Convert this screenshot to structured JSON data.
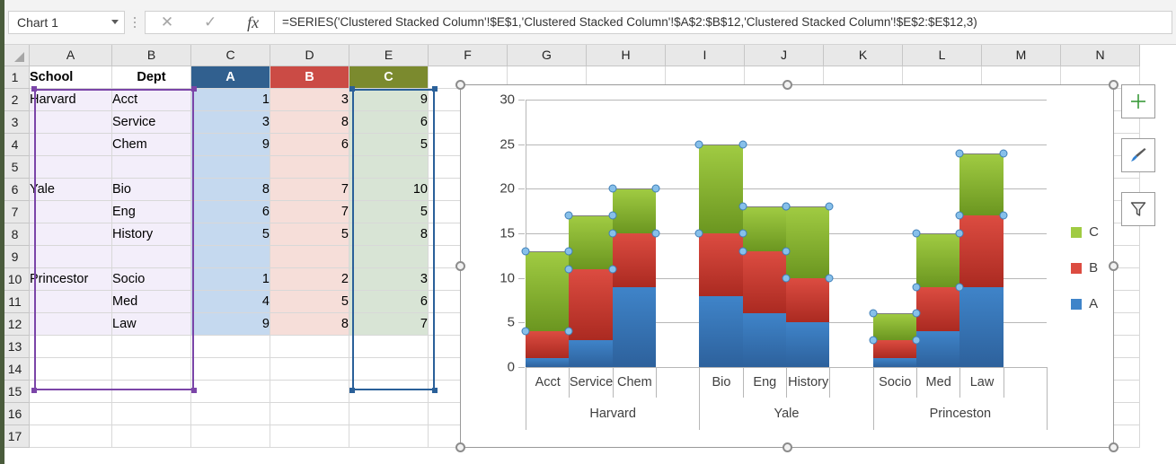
{
  "formula_bar": {
    "name_box": "Chart 1",
    "cancel_icon": "close-icon",
    "confirm_icon": "check-icon",
    "function_icon": "fx-icon",
    "formula": "=SERIES('Clustered Stacked Column'!$E$1,'Clustered Stacked Column'!$A$2:$B$12,'Clustered Stacked Column'!$E$2:$E$12,3)"
  },
  "sheet": {
    "column_headers": [
      "A",
      "B",
      "C",
      "D",
      "E",
      "F",
      "G",
      "H",
      "I",
      "J",
      "K",
      "L",
      "M",
      "N"
    ],
    "row_numbers": [
      "1",
      "2",
      "3",
      "4",
      "5",
      "6",
      "7",
      "8",
      "9",
      "10",
      "11",
      "12",
      "13",
      "14",
      "15",
      "16",
      "17"
    ],
    "header_row": {
      "a": "School",
      "b": "Dept",
      "c": "A",
      "d": "B",
      "e": "C"
    },
    "rows": [
      {
        "n": "2",
        "school": "Harvard",
        "dept": "Acct",
        "a": "1",
        "b": "3",
        "c": "9"
      },
      {
        "n": "3",
        "school": "",
        "dept": "Service",
        "a": "3",
        "b": "8",
        "c": "6"
      },
      {
        "n": "4",
        "school": "",
        "dept": "Chem",
        "a": "9",
        "b": "6",
        "c": "5"
      },
      {
        "n": "5",
        "school": "",
        "dept": "",
        "a": "",
        "b": "",
        "c": ""
      },
      {
        "n": "6",
        "school": "Yale",
        "dept": "Bio",
        "a": "8",
        "b": "7",
        "c": "10"
      },
      {
        "n": "7",
        "school": "",
        "dept": "Eng",
        "a": "6",
        "b": "7",
        "c": "5"
      },
      {
        "n": "8",
        "school": "",
        "dept": "History",
        "a": "5",
        "b": "5",
        "c": "8"
      },
      {
        "n": "9",
        "school": "",
        "dept": "",
        "a": "",
        "b": "",
        "c": ""
      },
      {
        "n": "10",
        "school": "Princestor",
        "dept": "Socio",
        "a": "1",
        "b": "2",
        "c": "3"
      },
      {
        "n": "11",
        "school": "",
        "dept": "Med",
        "a": "4",
        "b": "5",
        "c": "6"
      },
      {
        "n": "12",
        "school": "",
        "dept": "Law",
        "a": "9",
        "b": "8",
        "c": "7"
      }
    ],
    "empty_rows": [
      "13",
      "14",
      "15",
      "16",
      "17"
    ],
    "header_colors": {
      "a": "#31608f",
      "b": "#cb4b45",
      "c": "#7b8a2e"
    }
  },
  "chart_buttons": [
    {
      "name": "chart-elements-button",
      "icon": "plus-icon"
    },
    {
      "name": "chart-styles-button",
      "icon": "paintbrush-icon"
    },
    {
      "name": "chart-filters-button",
      "icon": "funnel-icon"
    }
  ],
  "chart_data": {
    "type": "bar",
    "title": "",
    "xlabel": "",
    "ylabel": "",
    "ylim": [
      0,
      30
    ],
    "yticks": [
      0,
      5,
      10,
      15,
      20,
      25,
      30
    ],
    "grid": true,
    "stacked": true,
    "legend_position": "right",
    "groups": [
      "Harvard",
      "Yale",
      "Princeston"
    ],
    "categories": [
      "Acct",
      "Service",
      "Chem",
      "Bio",
      "Eng",
      "History",
      "Socio",
      "Med",
      "Law"
    ],
    "category_groups": [
      {
        "group": "Harvard",
        "categories": [
          "Acct",
          "Service",
          "Chem"
        ]
      },
      {
        "group": "Yale",
        "categories": [
          "Bio",
          "Eng",
          "History"
        ]
      },
      {
        "group": "Princeston",
        "categories": [
          "Socio",
          "Med",
          "Law"
        ]
      }
    ],
    "series": [
      {
        "name": "A",
        "color": "#3f84c9",
        "values": [
          1,
          3,
          9,
          8,
          6,
          5,
          1,
          4,
          9
        ]
      },
      {
        "name": "B",
        "color": "#dc4c41",
        "values": [
          3,
          8,
          6,
          7,
          7,
          5,
          2,
          5,
          8
        ]
      },
      {
        "name": "C",
        "color": "#a0cb42",
        "values": [
          9,
          6,
          5,
          10,
          5,
          8,
          3,
          6,
          7
        ]
      }
    ],
    "stack_totals": [
      13,
      17,
      20,
      25,
      18,
      18,
      6,
      15,
      24
    ],
    "selected_series": "C",
    "legend": [
      "C",
      "B",
      "A"
    ]
  }
}
